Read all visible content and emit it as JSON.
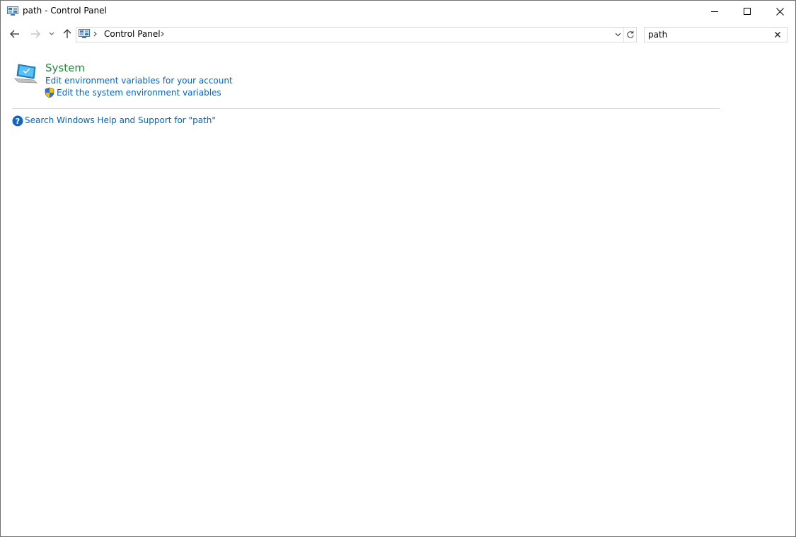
{
  "window": {
    "title": "path - Control Panel"
  },
  "address": {
    "crumb": "Control Panel"
  },
  "search": {
    "value": "path"
  },
  "results": {
    "category_title": "System",
    "links": [
      "Edit environment variables for your account",
      "Edit the system environment variables"
    ],
    "help_text": "Search Windows Help and Support for \"path\""
  },
  "colors": {
    "title_green": "#1e8a3a",
    "link_blue": "#0066cc",
    "divider": "#d6d6d6"
  },
  "icons": {
    "title": "control-panel-icon",
    "address": "control-panel-icon",
    "result": "system-laptop-icon",
    "admin": "uac-shield-icon",
    "help": "help-question-icon"
  }
}
